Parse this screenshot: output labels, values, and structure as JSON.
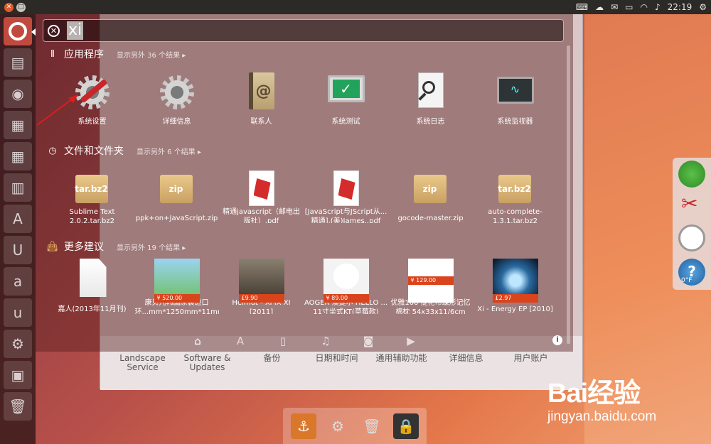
{
  "top_panel": {
    "time": "22:19",
    "indicators": [
      "keyboard-icon",
      "cloud-icon",
      "mail-icon",
      "battery-icon",
      "wifi-icon",
      "speaker-icon",
      "gear-icon"
    ]
  },
  "search": {
    "query": "xi"
  },
  "categories": [
    {
      "title": "应用程序",
      "more": "显示另外 36 个结果",
      "items": [
        {
          "label": "系统设置",
          "icon": "system-settings-icon"
        },
        {
          "label": "详细信息",
          "icon": "details-gear-icon"
        },
        {
          "label": "联系人",
          "icon": "contacts-icon"
        },
        {
          "label": "系统测试",
          "icon": "system-testing-icon"
        },
        {
          "label": "系统日志",
          "icon": "system-log-icon"
        },
        {
          "label": "系统监视器",
          "icon": "system-monitor-icon"
        }
      ]
    },
    {
      "title": "文件和文件夹",
      "more": "显示另外 6 个结果",
      "items": [
        {
          "label": "Sublime Text 2.0.2.tar.bz2",
          "badge": "tar.bz2",
          "icon": "archive-icon"
        },
        {
          "label": "ppk+on+JavaScript.zip",
          "badge": "zip",
          "icon": "archive-icon"
        },
        {
          "label": "精通javascript（邮电出版社）.pdf",
          "icon": "pdf-icon"
        },
        {
          "label": "[JavaScript与JScript从...精通].(美)James..pdf",
          "icon": "pdf-icon"
        },
        {
          "label": "gocode-master.zip",
          "badge": "zip",
          "icon": "archive-icon"
        },
        {
          "label": "auto-complete-1.3.1.tar.bz2",
          "badge": "tar.bz2",
          "icon": "archive-icon"
        }
      ]
    },
    {
      "title": "更多建议",
      "more": "显示另外 19 个结果",
      "items": [
        {
          "label": "嘉人(2013年11月刊)",
          "icon": "document-icon"
        },
        {
          "label": "康贝儿韩国原装进口环...mm*1250mm*11mm",
          "price": "¥ 520.00",
          "icon": "product-thumb"
        },
        {
          "label": "Helmut - XI IX XI [2011]",
          "price": "£9.90",
          "icon": "album-thumb"
        },
        {
          "label": "AOGER 澳捷尔 HELLO ... 11寸坐式KT(草莓款)",
          "price": "¥ 89.00",
          "icon": "product-thumb"
        },
        {
          "label": "优雅100 提花布蝶形记忆棉枕 54x33x11/6cm",
          "price": "¥ 129.00",
          "icon": "product-thumb"
        },
        {
          "label": "Xi - Energy EP [2010]",
          "price": "£2.97",
          "icon": "album-thumb"
        }
      ]
    }
  ],
  "scopes": [
    "home-lens-icon",
    "applications-lens-icon",
    "files-lens-icon",
    "music-lens-icon",
    "photos-lens-icon",
    "video-lens-icon"
  ],
  "settings_behind": [
    "Landscape Service",
    "Software & Updates",
    "备份",
    "日期和时间",
    "通用辅助功能",
    "详细信息",
    "用户账户"
  ],
  "weather": "0°F",
  "watermark": {
    "brand": "Bai经验",
    "url": "jingyan.baidu.com"
  },
  "colors": {
    "accent": "#d9441d",
    "launcher_home": "#c14a3f"
  }
}
